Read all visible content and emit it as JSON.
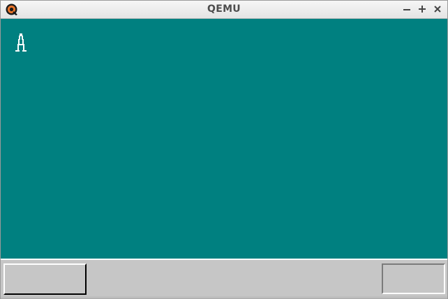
{
  "window": {
    "title": "QEMU",
    "background_color": "#008080"
  },
  "titlebar": {
    "app_icon": "qemu-logo-icon",
    "controls": [
      {
        "name": "minimize",
        "icon": "minus-icon"
      },
      {
        "name": "maximize",
        "icon": "plus-icon"
      },
      {
        "name": "close",
        "icon": "x-icon"
      }
    ]
  },
  "desktop": {
    "cursor_icon": "compass-cursor-icon"
  },
  "taskbar": {
    "background_color": "#c6c6c6",
    "left_button_label": "",
    "right_button_label": ""
  }
}
